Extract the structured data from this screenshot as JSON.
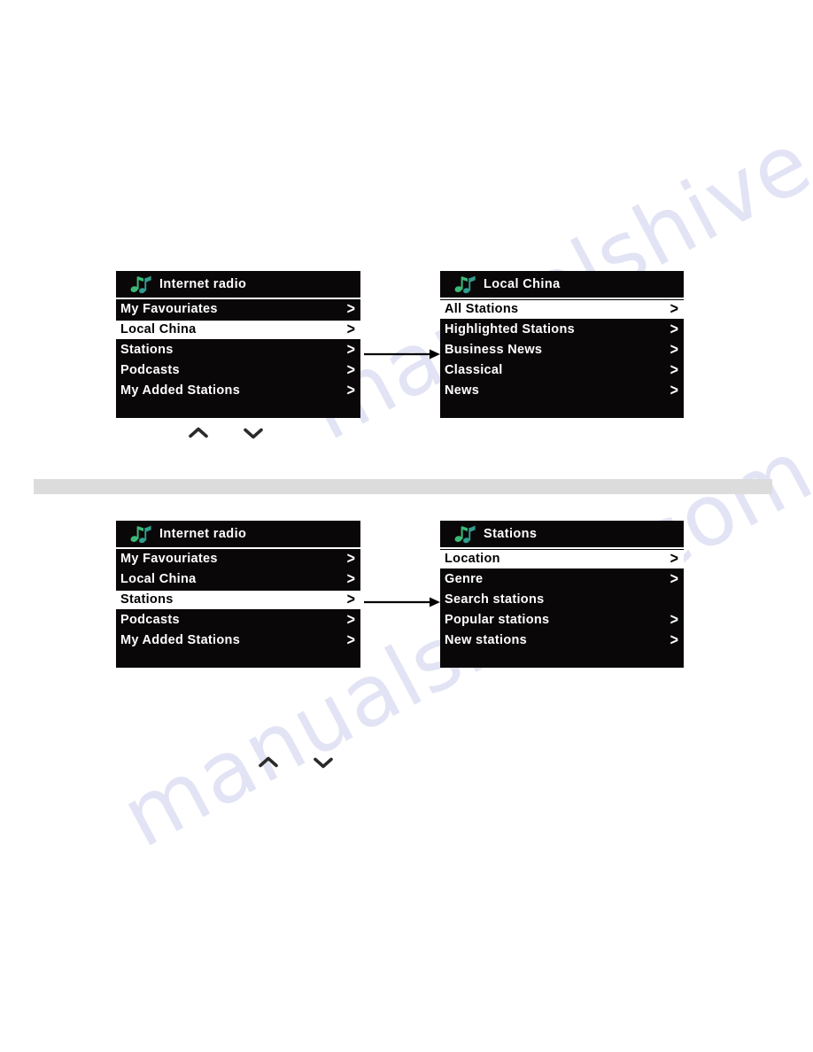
{
  "page": {
    "background_color": "#ffffff",
    "watermark_text": "manualshive.com",
    "watermark_color": "#5b5fc0"
  },
  "separator_band": {
    "color": "#dcdcdc"
  },
  "icons": {
    "music_note": "music-note-icon",
    "chevron_up": "chevron-up-icon",
    "chevron_down": "chevron-down-icon",
    "chevron_right": ">",
    "note_green": "#3cb878",
    "note_teal": "#2f9e8f"
  },
  "figures": [
    {
      "id": "figure-1",
      "source_screen": {
        "title": "Internet radio",
        "selected_index": 1,
        "items": [
          {
            "label": "My Favouriates",
            "chevron": true
          },
          {
            "label": "Local China",
            "chevron": true
          },
          {
            "label": "Stations",
            "chevron": true
          },
          {
            "label": "Podcasts",
            "chevron": true
          },
          {
            "label": "My Added Stations",
            "chevron": true
          }
        ]
      },
      "target_screen": {
        "title": "Local China",
        "selected_index": 0,
        "items": [
          {
            "label": "All Stations",
            "chevron": true
          },
          {
            "label": "Highlighted Stations",
            "chevron": true
          },
          {
            "label": "Business News",
            "chevron": true
          },
          {
            "label": "Classical",
            "chevron": true
          },
          {
            "label": "News",
            "chevron": true
          }
        ]
      },
      "nav": {
        "up_label": "scroll up",
        "down_label": "scroll down"
      }
    },
    {
      "id": "figure-2",
      "source_screen": {
        "title": "Internet radio",
        "selected_index": 2,
        "items": [
          {
            "label": "My Favouriates",
            "chevron": true
          },
          {
            "label": "Local China",
            "chevron": true
          },
          {
            "label": "Stations",
            "chevron": true
          },
          {
            "label": "Podcasts",
            "chevron": true
          },
          {
            "label": "My Added Stations",
            "chevron": true
          }
        ]
      },
      "target_screen": {
        "title": "Stations",
        "selected_index": 0,
        "items": [
          {
            "label": "Location",
            "chevron": true
          },
          {
            "label": "Genre",
            "chevron": true
          },
          {
            "label": "Search stations",
            "chevron": false
          },
          {
            "label": "Popular stations",
            "chevron": true
          },
          {
            "label": "New stations",
            "chevron": true
          }
        ]
      },
      "nav": {
        "up_label": "scroll up",
        "down_label": "scroll down"
      }
    }
  ]
}
